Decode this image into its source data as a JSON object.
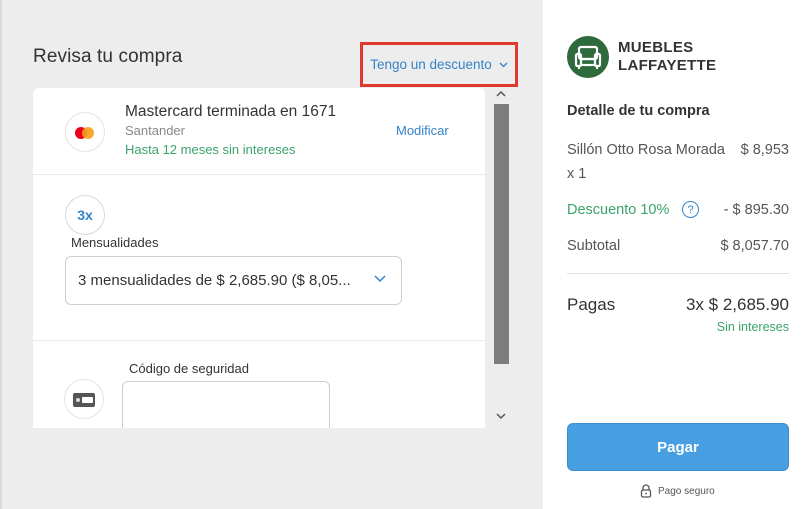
{
  "page": {
    "title": "Revisa tu compra",
    "discount_link": "Tengo un descuento"
  },
  "payment_method": {
    "card_name": "Mastercard terminada en 1671",
    "bank": "Santander",
    "promo": "Hasta 12 meses sin intereses",
    "modify": "Modificar"
  },
  "installments": {
    "badge": "3x",
    "label": "Mensualidades",
    "selected": "3 mensualidades de $ 2,685.90 ($ 8,05..."
  },
  "security": {
    "label": "Código de seguridad",
    "value": ""
  },
  "merchant": {
    "name_line1": "MUEBLES",
    "name_line2": "LAFFAYETTE",
    "logo_color": "#2f6a3c"
  },
  "summary": {
    "title": "Detalle de tu compra",
    "item_name": "Sillón Otto Rosa Morada",
    "item_price": "$ 8,953",
    "item_qty": "x 1",
    "discount_label": "Descuento 10%",
    "discount_value": "- $ 895.30",
    "subtotal_label": "Subtotal",
    "subtotal_value": "$ 8,057.70",
    "pay_label": "Pagas",
    "pay_value": "3x $ 2,685.90",
    "pay_note": "Sin intereses"
  },
  "actions": {
    "pay_button": "Pagar",
    "secure_text": "Pago seguro"
  },
  "colors": {
    "accent_blue": "#3483c7",
    "button_blue": "#479fe1",
    "green": "#3aa36b",
    "highlight_red": "#e0392d"
  },
  "icons": [
    "chevron-down-icon",
    "mastercard-icon",
    "card-cvv-icon",
    "help-icon",
    "lock-icon",
    "armchair-logo-icon",
    "scroll-up-icon",
    "scroll-down-icon"
  ]
}
